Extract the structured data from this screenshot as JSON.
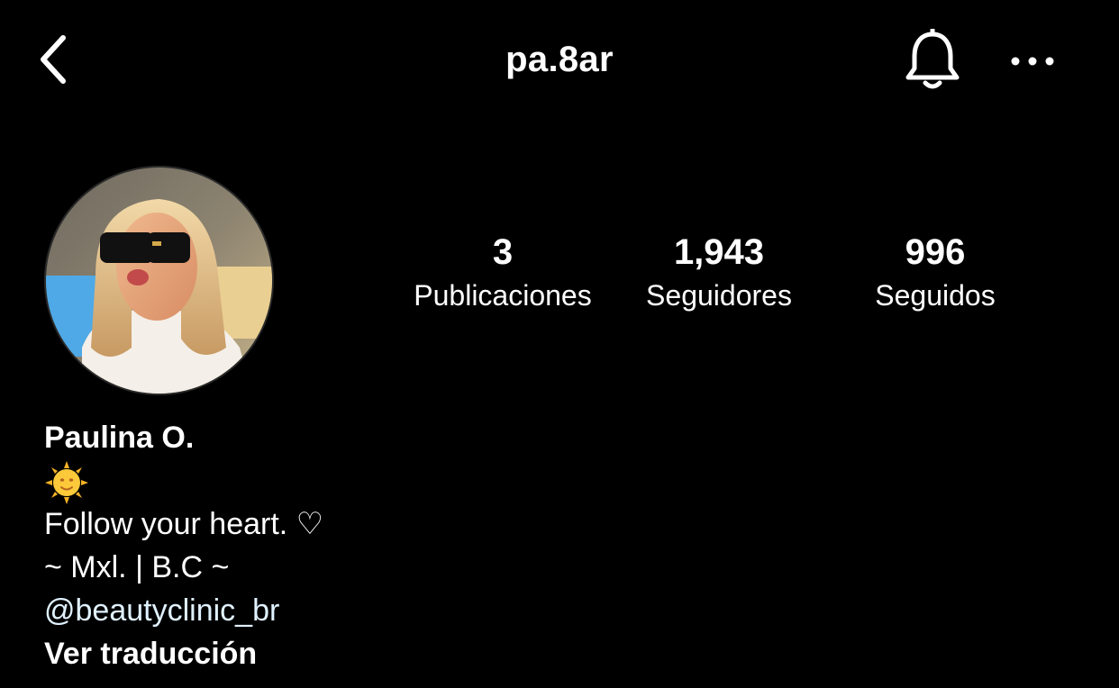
{
  "header": {
    "username": "pa.8ar",
    "back_icon": "chevron-left-icon",
    "notifications_icon": "bell-icon",
    "more_icon": "more-horizontal-icon"
  },
  "profile": {
    "stats": {
      "posts_count": "3",
      "posts_label": "Publicaciones",
      "followers_count": "1,943",
      "followers_label": "Seguidores",
      "following_count": "996",
      "following_label": "Seguidos"
    },
    "bio": {
      "name": "Paulina O.",
      "emoji": "🌞",
      "line1": "Follow your heart. ♡",
      "line2": "~ Mxl. | B.C ~",
      "mention": "@beautyclinic_br",
      "translate": "Ver traducción"
    }
  },
  "colors": {
    "background": "#000000",
    "text": "#ffffff",
    "mention": "#e0f1ff"
  }
}
